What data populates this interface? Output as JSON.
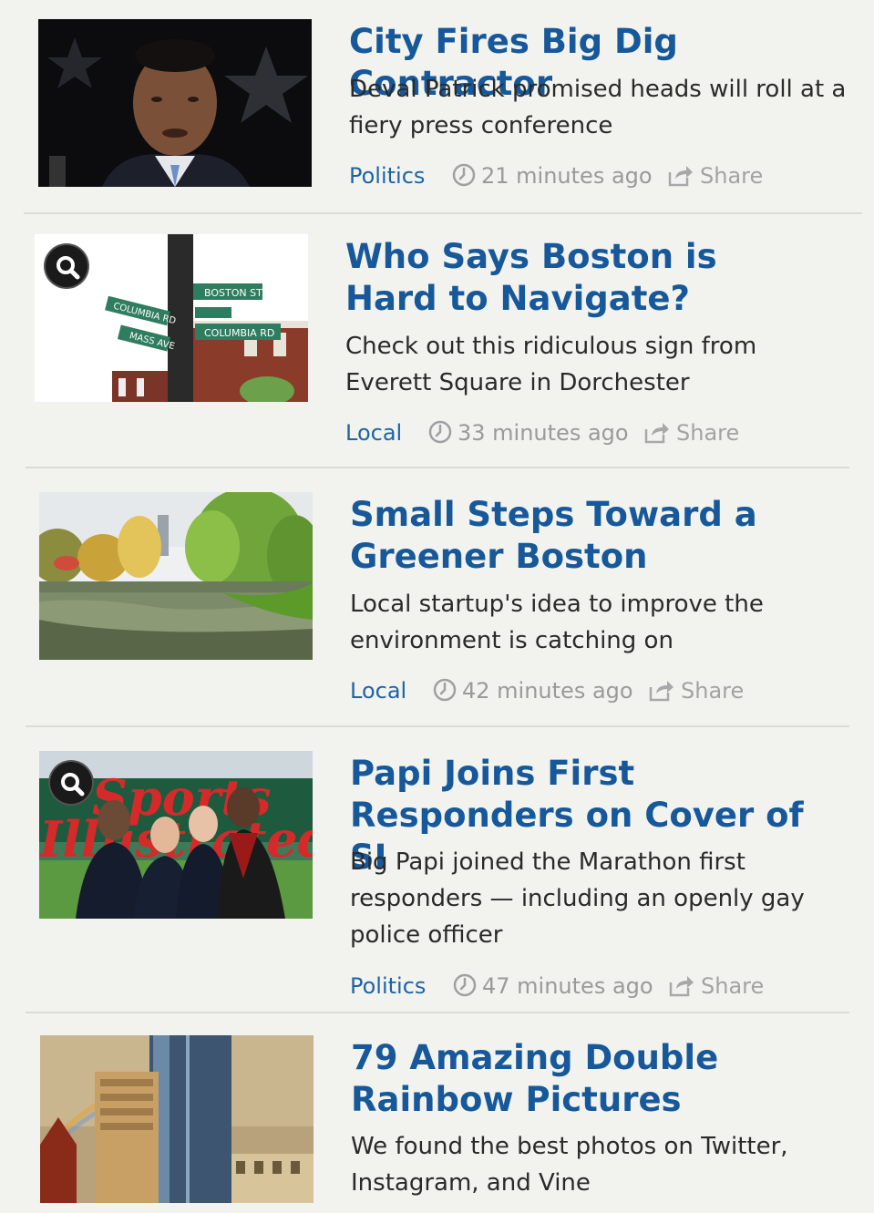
{
  "articles": [
    {
      "title": "City Fires Big Dig Contractor",
      "summary": "Deval Patrick promised heads will roll at a fiery press conference",
      "category": "Politics",
      "time": "21 minutes ago",
      "share": "Share",
      "has_gallery_icon": false
    },
    {
      "title": "Who Says Boston is Hard to Navigate?",
      "summary": "Check out this ridiculous sign from Everett Square in Dorchester",
      "category": "Local",
      "time": "33 minutes ago",
      "share": "Share",
      "has_gallery_icon": true
    },
    {
      "title": "Small Steps Toward a Greener Boston",
      "summary": "Local startup's idea to improve the environment is catching on",
      "category": "Local",
      "time": "42 minutes ago",
      "share": "Share",
      "has_gallery_icon": false
    },
    {
      "title": "Papi Joins First Responders on Cover of SI",
      "summary": "Big Papi joined the Marathon first responders — including an openly gay police officer",
      "category": "Politics",
      "time": "47 minutes ago",
      "share": "Share",
      "has_gallery_icon": true
    },
    {
      "title": "79 Amazing Double Rainbow Pictures",
      "summary": "We found the best photos on Twitter, Instagram, and Vine",
      "category": "",
      "time": "",
      "share": "",
      "has_gallery_icon": false
    }
  ],
  "icons": {
    "time": "clock-icon",
    "share": "share-icon",
    "gallery": "magnifier-icon"
  },
  "colors": {
    "headline": "#16589a",
    "category": "#1d64a6",
    "muted": "#9a9a9a",
    "background": "#f2f3ee"
  }
}
